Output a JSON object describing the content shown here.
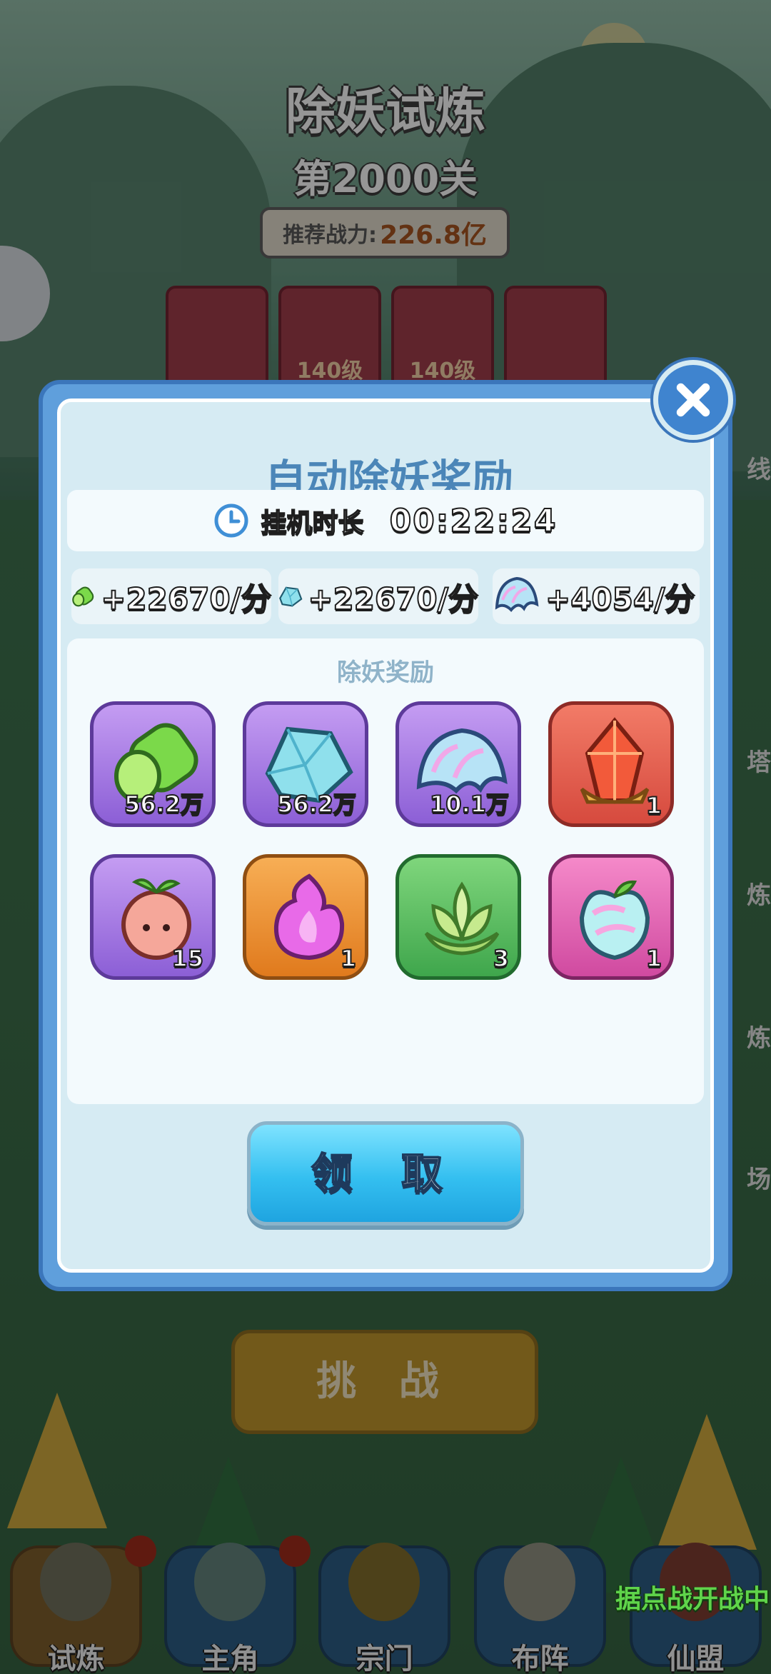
{
  "background": {
    "title": "除妖试炼",
    "stage": "第2000关",
    "power_label": "推荐战力:",
    "power_value": "226.8亿",
    "cards": [
      "",
      "140级",
      "140级",
      ""
    ],
    "side_labels": [
      "线",
      "塔",
      "炼",
      "炼",
      "场"
    ],
    "challenge_button": "挑 战"
  },
  "modal": {
    "title": "自动除妖奖励",
    "idle_label": "挂机时长",
    "idle_time": "00:22:24",
    "rates": [
      {
        "icon": "green-bamboo-icon",
        "text": "+22670/分"
      },
      {
        "icon": "blue-crystal-icon",
        "text": "+22670/分"
      },
      {
        "icon": "rainbow-scale-icon",
        "text": "+4054/分"
      }
    ],
    "rewards_title": "除妖奖励",
    "rewards": [
      {
        "icon": "green-bamboo-icon",
        "count": "56.2万",
        "frame": "purple"
      },
      {
        "icon": "blue-crystal-icon",
        "count": "56.2万",
        "frame": "purple"
      },
      {
        "icon": "rainbow-scale-icon",
        "count": "10.1万",
        "frame": "purple"
      },
      {
        "icon": "red-gem-icon",
        "count": "1",
        "frame": "red"
      },
      {
        "icon": "peach-fruit-icon",
        "count": "15",
        "frame": "purple"
      },
      {
        "icon": "pink-flame-icon",
        "count": "1",
        "frame": "orange"
      },
      {
        "icon": "lotus-icon",
        "count": "3",
        "frame": "green"
      },
      {
        "icon": "rainbow-peach-icon",
        "count": "1",
        "frame": "pink"
      }
    ],
    "claim_button": "领 取"
  },
  "nav": {
    "items": [
      {
        "label": "试炼",
        "active": true
      },
      {
        "label": "主角",
        "active": false
      },
      {
        "label": "宗门",
        "active": false
      },
      {
        "label": "布阵",
        "active": false
      },
      {
        "label": "仙盟",
        "active": false
      }
    ],
    "war_banner": "据点战开战中"
  },
  "colors": {
    "modal_border": "#3b76bb",
    "modal_bg": "#d6ebf3",
    "title": "#4b86b8",
    "claim": "#34bff0"
  }
}
